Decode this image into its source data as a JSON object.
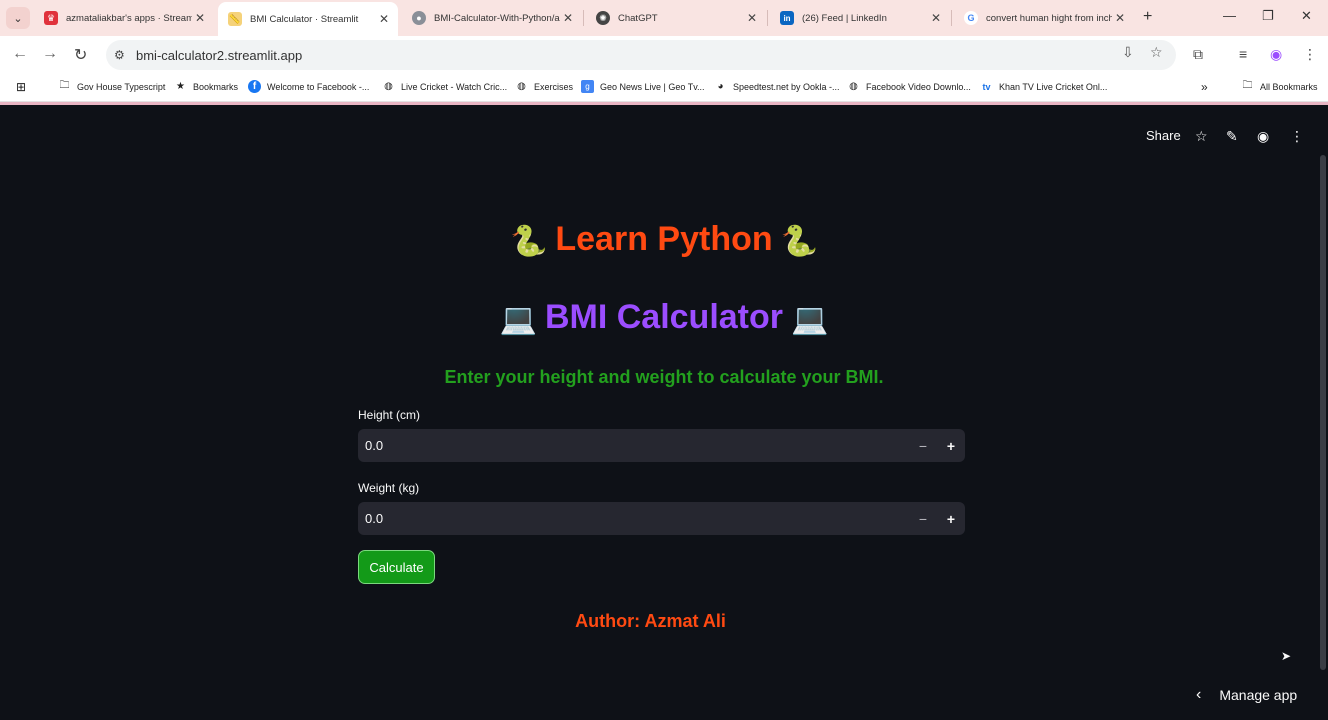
{
  "browser": {
    "tabs": [
      {
        "title": "azmataliakbar's apps · Streamlit",
        "favicon": "streamlit-crown-icon",
        "color": "#e0323c"
      },
      {
        "title": "BMI Calculator · Streamlit",
        "favicon": "ruler-icon",
        "color": "#d9a21b",
        "active": true
      },
      {
        "title": "BMI-Calculator-With-Python/ap",
        "favicon": "github-icon",
        "color": "#8a8f98"
      },
      {
        "title": "ChatGPT",
        "favicon": "chatgpt-icon",
        "color": "#444444"
      },
      {
        "title": "(26) Feed | LinkedIn",
        "favicon": "linkedin-icon",
        "color": "#0a66c2"
      },
      {
        "title": "convert human hight from inch",
        "favicon": "google-icon",
        "color": "#4285f4"
      }
    ],
    "url": "bmi-calculator2.streamlit.app",
    "bookmarks": [
      {
        "label": "Gov House Typescript",
        "icon": "folder-icon"
      },
      {
        "label": "Bookmarks",
        "icon": "star-icon"
      },
      {
        "label": "Welcome to Facebook -...",
        "icon": "facebook-icon"
      },
      {
        "label": "Live Cricket - Watch Cric...",
        "icon": "globe-icon"
      },
      {
        "label": "Exercises",
        "icon": "globe-icon"
      },
      {
        "label": "Geo News Live | Geo Tv...",
        "icon": "geo-icon"
      },
      {
        "label": "Speedtest.net by Ookla -...",
        "icon": "speedtest-icon"
      },
      {
        "label": "Facebook Video Downlo...",
        "icon": "globe-icon"
      },
      {
        "label": "Khan TV Live Cricket Onl...",
        "icon": "tv-icon"
      }
    ],
    "all_bookmarks": "All Bookmarks"
  },
  "app": {
    "header": {
      "share": "Share"
    },
    "title": "Learn Python",
    "subtitle": "BMI Calculator",
    "instruction": "Enter your height and weight to calculate your BMI.",
    "height": {
      "label": "Height (cm)",
      "value": "0.0"
    },
    "weight": {
      "label": "Weight (kg)",
      "value": "0.0"
    },
    "calculate": "Calculate",
    "author": "Author: Azmat Ali",
    "manage_app": "Manage app"
  }
}
